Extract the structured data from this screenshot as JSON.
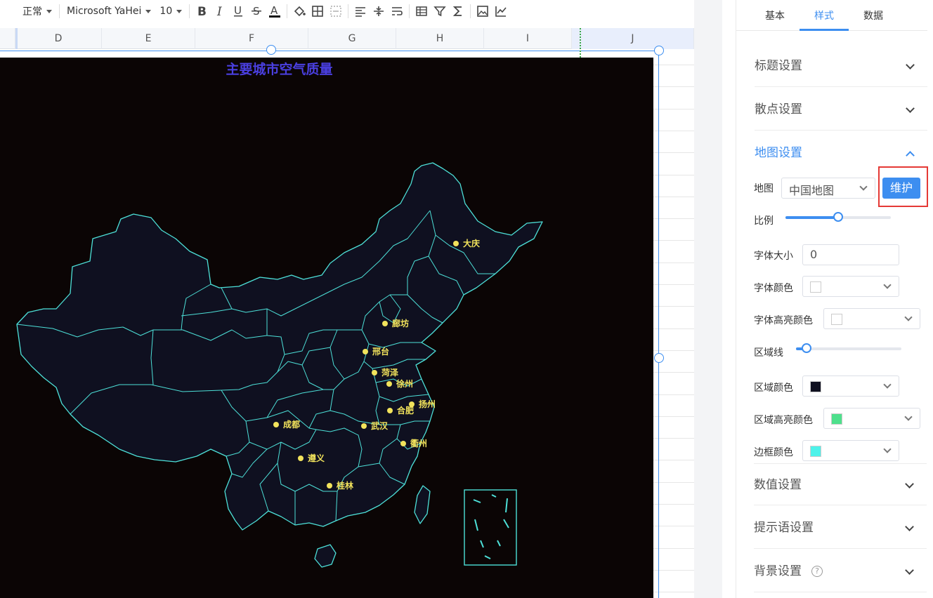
{
  "toolbar": {
    "style_value": "正常",
    "font_value": "Microsoft YaHei",
    "size_value": "10"
  },
  "columns": [
    "D",
    "E",
    "F",
    "G",
    "H",
    "I",
    "J"
  ],
  "chart": {
    "title": "主要城市空气质量",
    "cities": [
      {
        "name": "大庆"
      },
      {
        "name": "廊坊"
      },
      {
        "name": "邢台"
      },
      {
        "name": "菏泽"
      },
      {
        "name": "徐州"
      },
      {
        "name": "合肥"
      },
      {
        "name": "扬州"
      },
      {
        "name": "成都"
      },
      {
        "name": "武汉"
      },
      {
        "name": "衢州"
      },
      {
        "name": "遵义"
      },
      {
        "name": "桂林"
      }
    ],
    "colors": {
      "background": "#0b0505",
      "region": "#0f1020",
      "border": "#4de0d8",
      "point": "#f2e35c",
      "title": "#4a3fe0"
    }
  },
  "panel": {
    "tabs": [
      "基本",
      "样式",
      "数据"
    ],
    "active_tab": "样式",
    "sections_top": [
      "标题设置",
      "散点设置",
      "地图设置"
    ],
    "sections_bottom": [
      "数值设置",
      "提示语设置",
      "背景设置"
    ],
    "map_label": "地图",
    "map_value": "中国地图",
    "maintain_button": "维护",
    "ratio_label": "比例",
    "font_size_label": "字体大小",
    "font_size_value": "0",
    "font_color_label": "字体颜色",
    "font_highlight_label": "字体高亮颜色",
    "area_line_label": "区域线",
    "area_color_label": "区域颜色",
    "area_highlight_label": "区域高亮颜色",
    "border_color_label": "边框颜色",
    "colors": {
      "font": "#ffffff",
      "font_highlight": "#ffffff",
      "area": "#0f1020",
      "area_highlight": "#4ee08c",
      "border": "#4ef2ea"
    },
    "ratio_level": 0.5,
    "area_line_level": 0.1
  }
}
